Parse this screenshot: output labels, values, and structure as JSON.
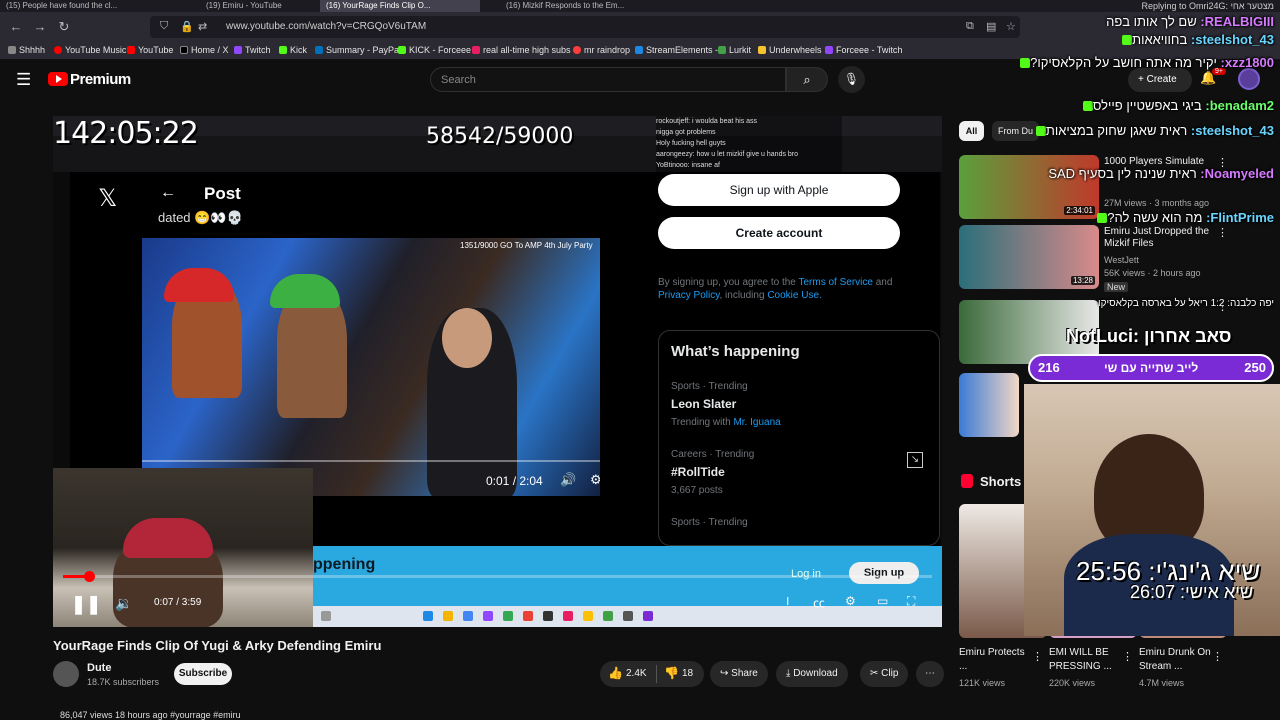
{
  "browser": {
    "tabs": [
      "(15) People have found the cl...",
      "(19) Emiru - YouTube",
      "(16) YourRage Finds Clip O...",
      "(16) Mizkif Responds to the Em..."
    ],
    "url": "www.youtube.com/watch?v=CRGQoV6uTAM",
    "bookmarks": [
      "Shhhh",
      "YouTube Music",
      "YouTube",
      "Home / X",
      "Twitch",
      "Kick",
      "Summary - PayPal",
      "KICK - Forceee",
      "real all-time high subs",
      "mr raindrop",
      "StreamElements -",
      "Lurkit",
      "Underwheels",
      "Forceee - Twitch"
    ]
  },
  "header": {
    "logo": "Premium",
    "search_placeholder": "Search",
    "create_label": "Create",
    "notification_badge": "9+"
  },
  "player": {
    "stream_time": "142:05:22",
    "sub_goal": "58542/59000",
    "inner_chat": [
      "rockoutjeff: i woulda beat his ass",
      "nigga got problems",
      "Holy fucking hell guyts",
      "aarongeezy: how u let mizkif give u hands bro",
      "YoBtinooo: insane af"
    ],
    "post_title": "Post",
    "post_text": "dated 😁👀💀",
    "clip_caption": "1351/9000 GO To AMP 4th July Party",
    "clip_time": "0:01 / 2:04",
    "signup_apple": "Sign up with Apple",
    "create_account": "Create account",
    "terms_prefix": "By signing up, you agree to the",
    "terms_tos": "Terms of Service",
    "terms_and": "and",
    "terms_privacy": "Privacy Policy",
    "terms_including": ", including",
    "terms_cookie": "Cookie Use.",
    "whats_happening": "What’s happening",
    "trends": [
      {
        "meta": "Sports · Trending",
        "name": "Leon Slater",
        "sub": "Trending with",
        "sub_link": "Mr. Iguana"
      },
      {
        "meta": "Careers · Trending",
        "name": "#RollTide",
        "sub": "3,667 posts",
        "sub_link": ""
      },
      {
        "meta": "Sports · Trending",
        "name": "",
        "sub": "",
        "sub_link": ""
      }
    ],
    "banner_text": "ppening",
    "banner_login": "Log in",
    "banner_signup": "Sign up",
    "time": "0:07 / 3:59",
    "progress": 0.03
  },
  "video": {
    "title": "YourRage Finds Clip Of Yugi & Arky Defending Emiru",
    "channel": "Dute",
    "subscribers": "18.7K subscribers",
    "subscribe_label": "Subscribe",
    "likes": "2.4K",
    "dislikes": "18",
    "share_label": "Share",
    "download_label": "Download",
    "clip_label": "Clip",
    "views_line": "86,047 views  18 hours ago  #yourrage #emiru"
  },
  "sidebar": {
    "chips": [
      "All",
      "From Du"
    ],
    "recommendations": [
      {
        "title": "1000 Players Simulate",
        "channel": "",
        "meta": "27M views · 3 months ago",
        "duration": "2:34:01",
        "thumb_colors": [
          "#5aa03c",
          "#c0392b"
        ]
      },
      {
        "title": "Emiru Just Dropped the Mizkif Files",
        "channel": "WestJett",
        "meta": "56K views · 2 hours ago",
        "badge": "New",
        "duration": "13:28",
        "thumb_colors": [
          "#2a6f7a",
          "#d98a8a"
        ]
      },
      {
        "title": "",
        "channel": "",
        "meta": "",
        "duration": "",
        "thumb_colors": [
          "#3b6a3a",
          "#e8e8e8"
        ]
      },
      {
        "title": "",
        "channel": "",
        "meta": "",
        "duration": "",
        "thumb_colors": [
          "#3a7ad6",
          "#f2d7c5"
        ]
      }
    ],
    "shorts_label": "Shorts",
    "shorts": [
      {
        "title": "Emiru Protects ...",
        "views": "121K views"
      },
      {
        "title": "EMI WILL BE PRESSING ...",
        "views": "220K views"
      },
      {
        "title": "Emiru Drunk On Stream ...",
        "views": "4.7M views"
      }
    ]
  },
  "overlay": {
    "replying": "Replying to Omri24G: מצטער אחי",
    "chat": [
      {
        "user": "REALBIGIII:",
        "msg": "שם לך אותו בפה",
        "color": "purple"
      },
      {
        "user": "steelshot_43:",
        "msg": "בחוויאאות",
        "color": "cyan"
      },
      {
        "user": "xzz1800:",
        "msg": "יקיר מה אתה חושב על הקלאסיקו?",
        "color": "purple"
      },
      {
        "user": "benadam2:",
        "msg": "ביגי באפשטיין פיילס",
        "color": "green"
      },
      {
        "user": "steelshot_43:",
        "msg": "ראית שאגן שחוק במציאות",
        "color": "cyan"
      },
      {
        "user": "Noamyeled:",
        "msg": "ראית שנינה לין בסעיף SAD",
        "color": "purple"
      },
      {
        "user": "FlintPrime:",
        "msg": "מה הוא עשה לה?",
        "color": "cyan"
      },
      {
        "user": "",
        "msg": "יפה כלבנה: 1:2 ריאל על בארסה בקלאסיקו",
        "color": "green"
      }
    ],
    "poll_name": "NotLuci: סאב אחרון",
    "poll_left": "216",
    "poll_right": "250",
    "poll_label": "לייב שתייה עם שי",
    "timer_1": "שיא ג'ינג'י: 25:56",
    "timer_2": "שיא אישי: 26:07"
  },
  "colors": {
    "yt_red": "#ff0000",
    "kick_green": "#53fc18",
    "poll_purple": "#7b2bd6",
    "twitter_blue": "#1d9bf0"
  }
}
